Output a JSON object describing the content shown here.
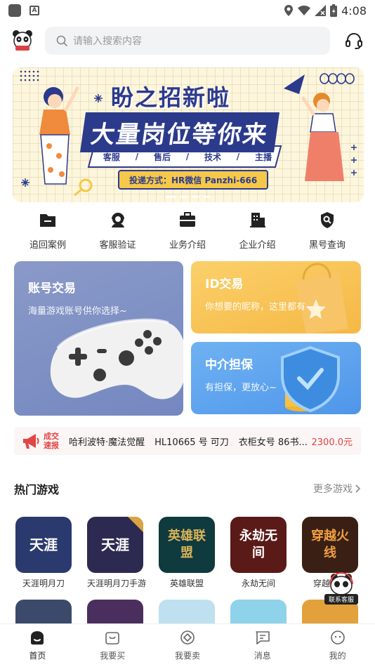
{
  "status_bar": {
    "time": "4:08"
  },
  "search": {
    "placeholder": "请输入搜索内容"
  },
  "banner": {
    "title_line1": "盼之招新啦",
    "title_line2": "大量岗位等你来",
    "tags": [
      "客服",
      "/",
      "售后",
      "/",
      "技术",
      "/",
      "主播"
    ],
    "contact": "投递方式：HR微信 Panzhi-666"
  },
  "quick_nav": [
    {
      "label": "追回案例",
      "icon": "folder-icon"
    },
    {
      "label": "客服验证",
      "icon": "support-agent-icon"
    },
    {
      "label": "业务介绍",
      "icon": "briefcase-icon"
    },
    {
      "label": "企业介绍",
      "icon": "building-icon"
    },
    {
      "label": "黑号查询",
      "icon": "shield-search-icon"
    }
  ],
  "cards": {
    "account": {
      "title": "账号交易",
      "subtitle": "海量游戏账号供你选择~"
    },
    "id": {
      "title": "ID交易",
      "subtitle": "你想要的昵称，这里都有~"
    },
    "guarantee": {
      "title": "中介担保",
      "subtitle": "有担保，更放心~"
    }
  },
  "ticker": {
    "badge_line1": "成交",
    "badge_line2": "速报",
    "items": [
      "哈利波特·魔法觉醒",
      "HL10665 号 可刀",
      "衣柜女号 86书..."
    ],
    "price": "2300.0元"
  },
  "hot_games": {
    "title": "热门游戏",
    "more": "更多游戏",
    "games": [
      {
        "name": "天涯明月刀",
        "tile": "天涯",
        "color": "#2b3a6e"
      },
      {
        "name": "天涯明月刀手游",
        "tile": "天涯",
        "color": "#2d2a52"
      },
      {
        "name": "英雄联盟",
        "tile": "英雄联盟",
        "color": "#0f3a3e"
      },
      {
        "name": "永劫无间",
        "tile": "永劫无间",
        "color": "#5a1a18"
      },
      {
        "name": "穿越火线",
        "tile": "穿越火线",
        "color": "#3a1f14"
      }
    ],
    "row2_colors": [
      "#3b4a6a",
      "#4a2f5e",
      "#bfe0ee",
      "#8fd3ea",
      "#e2a13a"
    ]
  },
  "float_service": {
    "label": "联系客服"
  },
  "tabbar": [
    {
      "label": "首页",
      "icon": "home-icon",
      "active": true
    },
    {
      "label": "我要买",
      "icon": "shopping-bag-icon",
      "active": false
    },
    {
      "label": "我要卖",
      "icon": "sell-icon",
      "active": false
    },
    {
      "label": "消息",
      "icon": "message-icon",
      "active": false
    },
    {
      "label": "我的",
      "icon": "profile-icon",
      "active": false
    }
  ]
}
